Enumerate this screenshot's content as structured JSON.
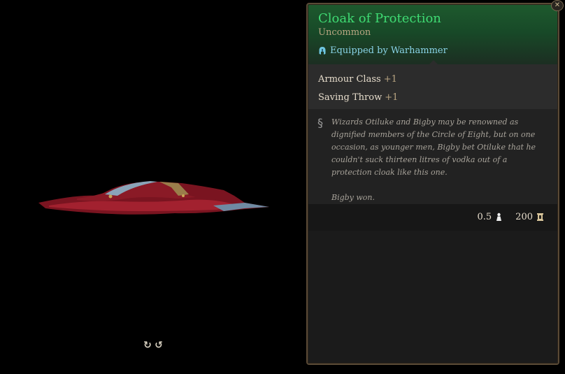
{
  "item": {
    "name": "Cloak of Protection",
    "rarity": "Uncommon",
    "equipped_text": "Equipped by Warhammer",
    "stats": [
      {
        "label": "Armour Class",
        "bonus": "+1"
      },
      {
        "label": "Saving Throw",
        "bonus": "+1"
      }
    ],
    "description": [
      "Wizards Otiluke and Bigby may be renowned as dignified members of the Circle of Eight, but on one occasion, as younger men, Bigby bet Otiluke that he couldn't suck thirteen litres of vodka out of a protection cloak like this one.",
      "Bigby won."
    ],
    "weight": "0.5",
    "value": "200"
  },
  "icons": {
    "close": "close-icon",
    "equipped": "helmet-icon",
    "lore": "quill-icon",
    "weight": "weight-icon",
    "gold": "coin-icon",
    "rotate_left": "rotate-left-icon",
    "rotate_right": "rotate-right-icon"
  },
  "colors": {
    "name": "#3fdb73",
    "rarity": "#b9a582",
    "equipped": "#8ad4e8",
    "border": "#5a4a36",
    "header_green": "#1e5a2e"
  }
}
